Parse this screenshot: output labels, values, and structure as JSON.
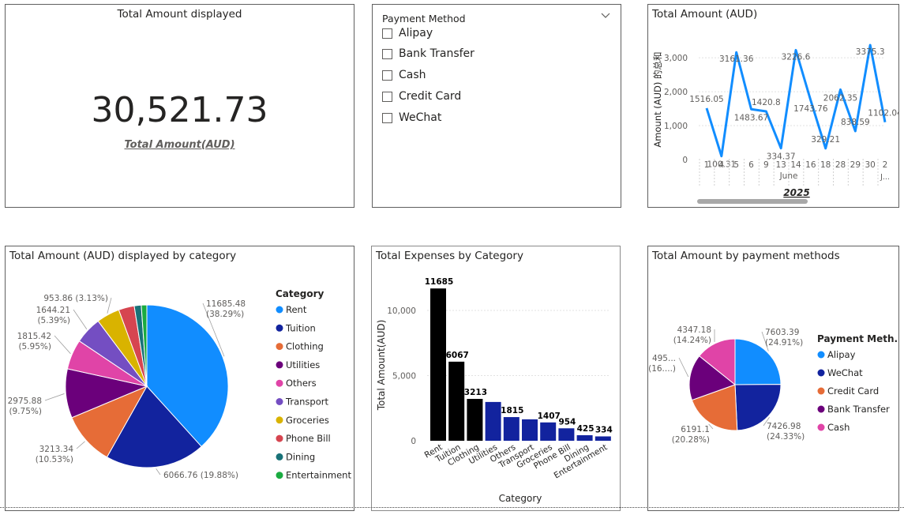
{
  "card": {
    "title": "Total Amount displayed",
    "value": "30,521.73",
    "label": "Total Amount(AUD)"
  },
  "slicer": {
    "header": "Payment Method",
    "options": [
      "Alipay",
      "Bank Transfer",
      "Cash",
      "Credit Card",
      "WeChat"
    ]
  },
  "line_tile": {
    "title": "Total Amount (AUD)"
  },
  "pie_cat_tile": {
    "title": "Total Amount (AUD) displayed by category",
    "legend_title": "Category"
  },
  "bar_tile": {
    "title": "Total Expenses by Category"
  },
  "pie_pay_tile": {
    "title": "Total Amount by payment methods",
    "legend_title": "Payment Meth..."
  },
  "colors": {
    "accent_blue": "#118DFF",
    "navy": "#12239E",
    "orange": "#E66C37",
    "purple": "#6B007B",
    "pink": "#E044A7",
    "violet": "#744EC2",
    "yellow": "#D9B300",
    "red": "#D64550",
    "teal": "#197278",
    "green": "#1AAB40",
    "black": "#000000"
  },
  "chart_data": [
    {
      "id": "line",
      "type": "line",
      "ylabel": "Amount (AUD) 的总和",
      "x": [
        "1",
        "4",
        "5",
        "6",
        "9",
        "13",
        "14",
        "16",
        "18",
        "28",
        "29",
        "30",
        "2"
      ],
      "x_group_label": "June",
      "x_group_label_2": "J...",
      "x_year_label": "2025",
      "values": [
        1516.05,
        100.31,
        3161.36,
        1483.67,
        1420.8,
        334.37,
        3226.6,
        1743.76,
        329.21,
        2062.35,
        838.59,
        3375.3,
        1102.04
      ],
      "labels": [
        "1516.05",
        "100.31",
        "3161.36",
        "1483.67",
        "1420.8",
        "334.37",
        "3226.6",
        "1743.76",
        "329.21",
        "2062.35",
        "838.59",
        "3375.3",
        "1102.04"
      ],
      "ylim": [
        0,
        3400
      ],
      "yticks": [
        "0",
        "1,000",
        "2,000",
        "3,000"
      ],
      "color": "#118DFF"
    },
    {
      "id": "pie_category",
      "type": "pie",
      "categories": [
        "Rent",
        "Tuition",
        "Clothing",
        "Utilities",
        "Others",
        "Transport",
        "Groceries",
        "Phone Bill",
        "Dining",
        "Entertainment"
      ],
      "values": [
        11685.48,
        6066.76,
        3213.34,
        2975.88,
        1815.42,
        1644.21,
        1407,
        953.86,
        425,
        334
      ],
      "colors": [
        "#118DFF",
        "#12239E",
        "#E66C37",
        "#6B007B",
        "#E044A7",
        "#744EC2",
        "#D9B300",
        "#D64550",
        "#197278",
        "#1AAB40"
      ],
      "labels": [
        [
          "11685.48",
          "(38.29%)"
        ],
        [
          "6066.76 (19.88%)"
        ],
        [
          "3213.34",
          "(10.53%)"
        ],
        [
          "2975.88",
          "(9.75%)"
        ],
        [
          "1815.42",
          "(5.95%)"
        ],
        [
          "1644.21",
          "(5.39%)"
        ],
        [
          "953.86 (3.13%)"
        ]
      ]
    },
    {
      "id": "bar_category",
      "type": "bar",
      "categories": [
        "Rent",
        "Tuition",
        "Clothing",
        "Utilities",
        "Others",
        "Transport",
        "Groceries",
        "Phone Bill",
        "Dining",
        "Entertainment"
      ],
      "values": [
        11685,
        6067,
        3213,
        2976,
        1815,
        1644,
        1407,
        954,
        425,
        334
      ],
      "value_labels": [
        "11685",
        "6067",
        "3213",
        "",
        "1815",
        "",
        "1407",
        "954",
        "425",
        "334"
      ],
      "colors": [
        "#000000",
        "#000000",
        "#000000",
        "#12239E",
        "#12239E",
        "#12239E",
        "#12239E",
        "#12239E",
        "#12239E",
        "#12239E"
      ],
      "xlabel": "Category",
      "ylabel": "Total Amount(AUD)",
      "ylim": [
        0,
        12000
      ],
      "yticks": [
        "0",
        "5,000",
        "10,000"
      ]
    },
    {
      "id": "pie_payment",
      "type": "pie",
      "categories": [
        "Alipay",
        "WeChat",
        "Credit Card",
        "Bank Transfer",
        "Cash"
      ],
      "values": [
        7603.39,
        7426.98,
        6191.1,
        4953,
        4347.18
      ],
      "colors": [
        "#118DFF",
        "#12239E",
        "#E66C37",
        "#6B007B",
        "#E044A7"
      ],
      "labels": [
        [
          "7603.39",
          "(24.91%)"
        ],
        [
          "7426.98",
          "(24.33%)"
        ],
        [
          "6191.1",
          "(20.28%)"
        ],
        [
          "495...",
          "(16....)"
        ],
        [
          "4347.18",
          "(14.24%)"
        ]
      ]
    }
  ]
}
